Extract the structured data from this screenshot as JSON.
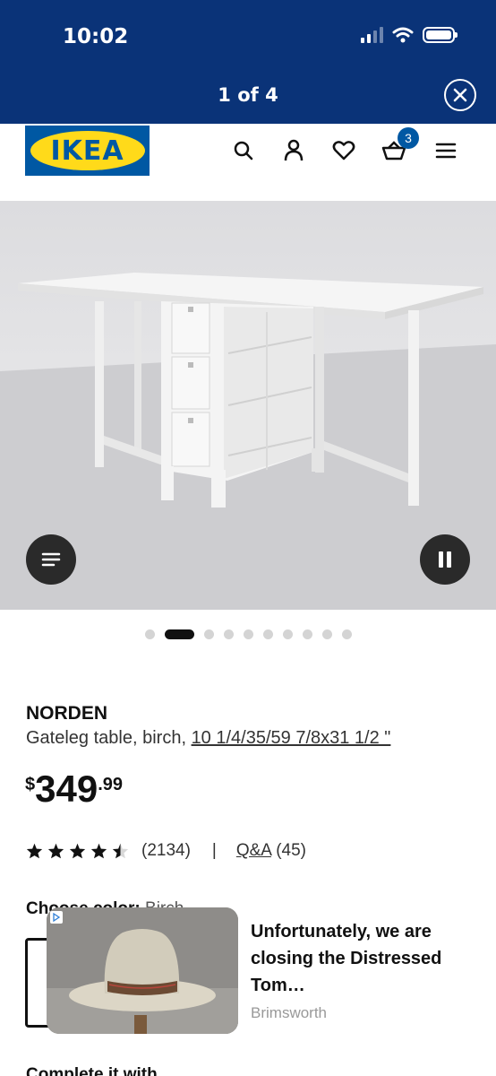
{
  "status_bar": {
    "time": "10:02"
  },
  "viewer": {
    "page_indicator": "1 of 4",
    "close_icon": "close-icon"
  },
  "header": {
    "logo_text": "IKEA",
    "icons": [
      "search-icon",
      "profile-icon",
      "heart-icon",
      "cart-icon",
      "menu-icon"
    ],
    "cart_count": "3",
    "brand_blue": "#0058a3",
    "brand_yellow": "#ffda1a"
  },
  "gallery": {
    "menu_button_icon": "list-icon",
    "pause_button_icon": "pause-icon",
    "dot_count": 10,
    "active_dot": 2
  },
  "product": {
    "name": "NORDEN",
    "description": "Gateleg table, birch,",
    "measurements": "10 1/4/35/59 7/8x31 1/2 \"",
    "price_currency": "$",
    "price_integer": "349",
    "price_decimal": ".99",
    "rating_value": 4.5,
    "rating_count": "(2134)",
    "separator": "|",
    "qa_label": "Q&A",
    "qa_count": "(45)"
  },
  "color_section": {
    "label": "Choose color:",
    "value": "Birch"
  },
  "ad": {
    "title": "Unfortunately, we are closing the Distressed Tom…",
    "source": "Brimsworth"
  },
  "bottom_text": "Complete it with"
}
